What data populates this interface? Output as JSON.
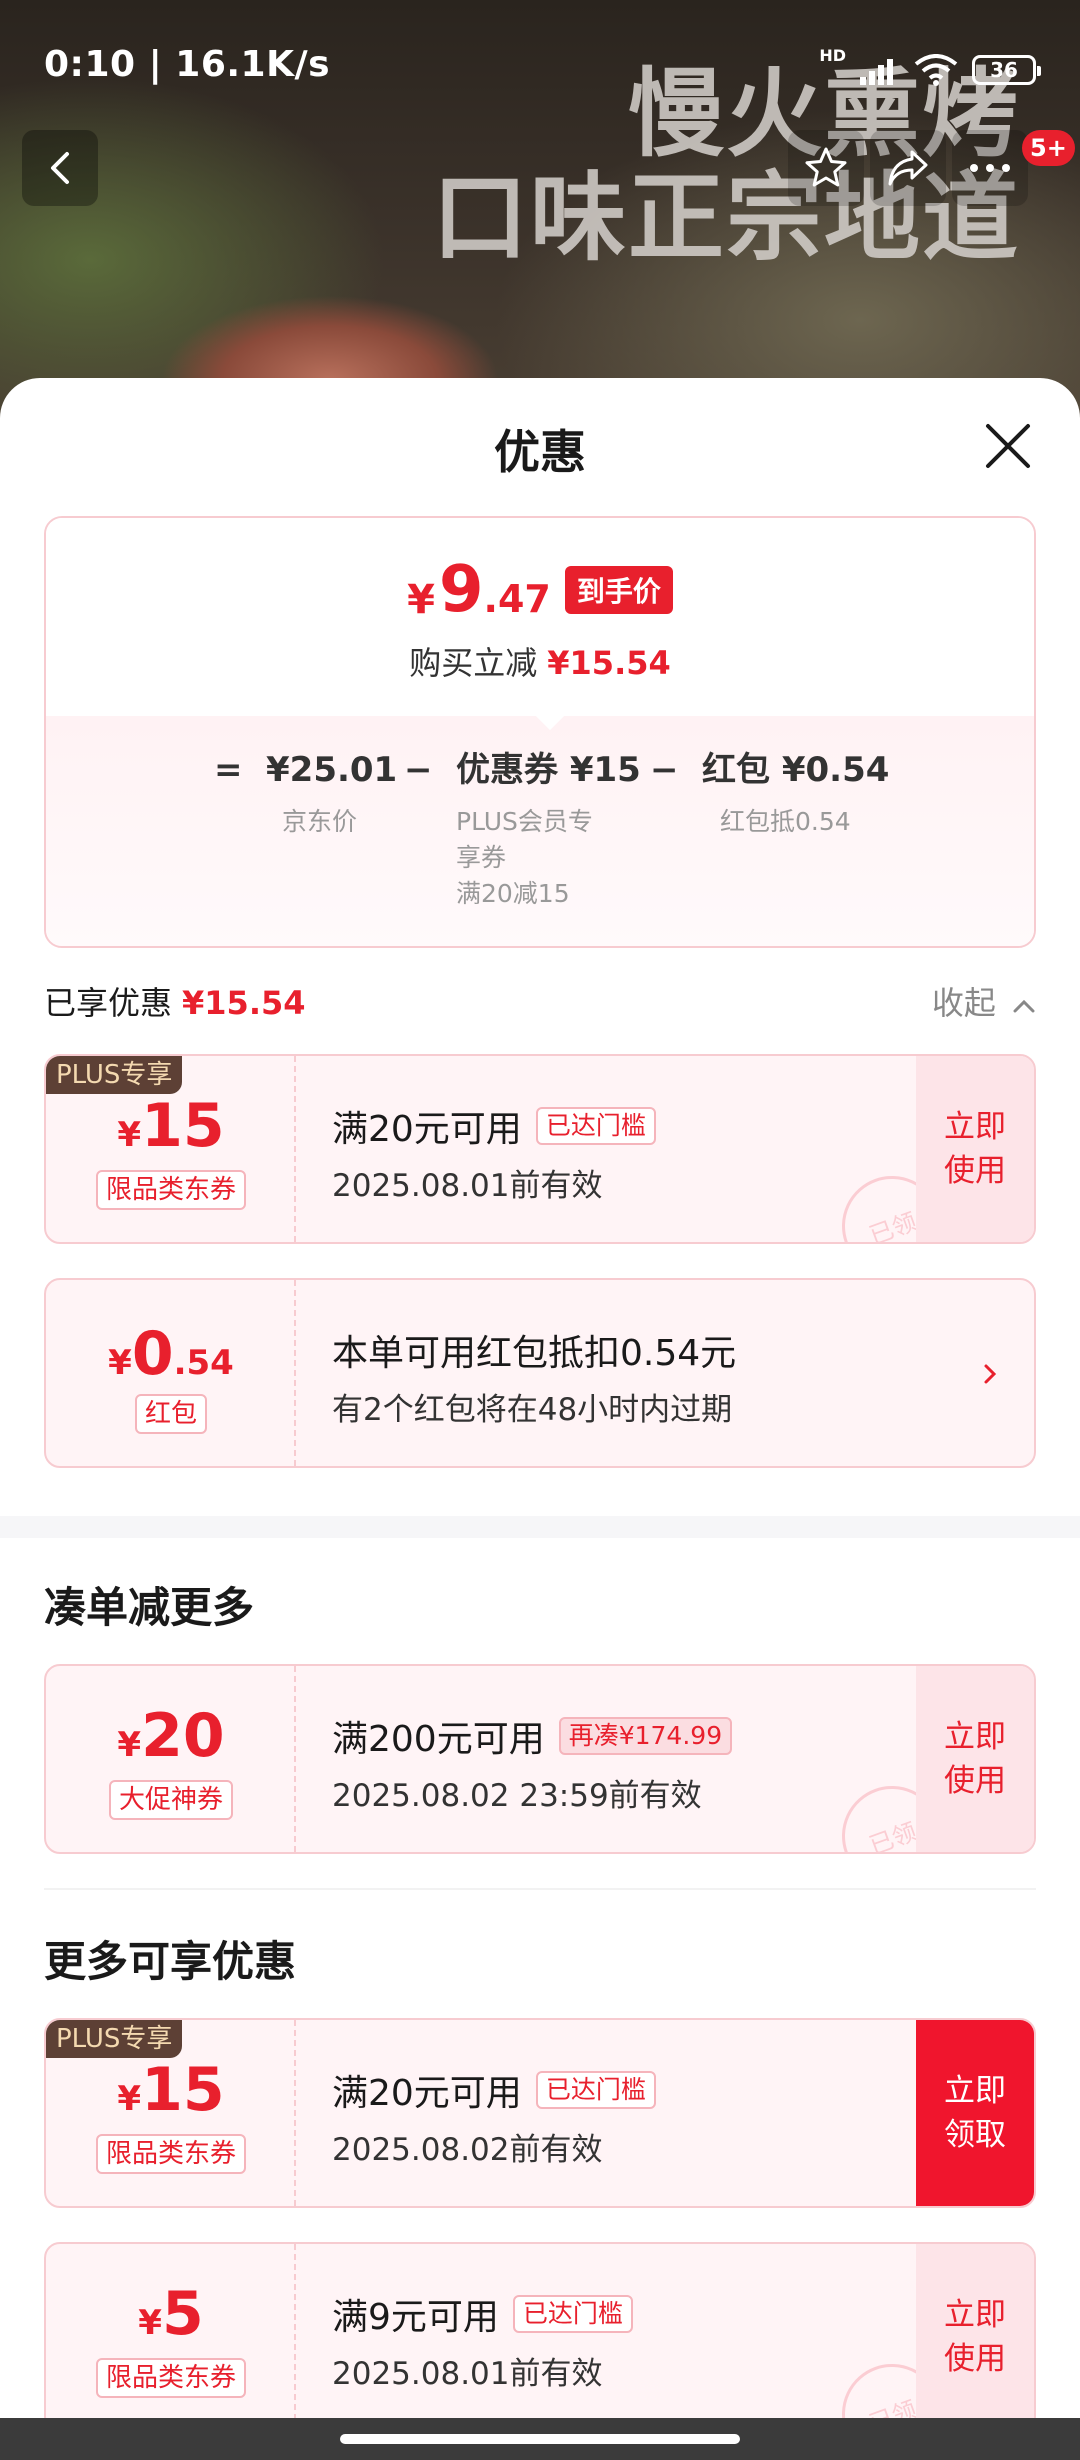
{
  "status_bar": {
    "time": "0:10",
    "speed": "16.1K/s",
    "network_label": "HD",
    "battery": "36"
  },
  "hero": {
    "slogan_line1": "慢火熏烤",
    "slogan_line2": "口味正宗地道",
    "notification_badge": "5+"
  },
  "sheet": {
    "title": "优惠",
    "price": {
      "currency": "¥",
      "integer": "9",
      "decimal": ".47",
      "tag": "到手价",
      "saving_label": "购买立减",
      "saving_value": "¥15.54"
    },
    "formula": {
      "equals": "=",
      "jd_price": "¥25.01",
      "minus": "−",
      "coupon": "优惠券 ¥15",
      "red_packet": "红包 ¥0.54",
      "jd_price_label": "京东价",
      "coupon_label_line1": "PLUS会员专",
      "coupon_label_line2": "享券",
      "coupon_label_line3": "满20减15",
      "red_packet_label": "红包抵0.54"
    },
    "enjoyed_label": "已享优惠",
    "enjoyed_value": "¥15.54",
    "collapse_label": "收起"
  },
  "enjoyed_coupons": [
    {
      "plus_tag": "PLUS专享",
      "currency": "¥",
      "amount": "15",
      "kind": "限品类东券",
      "condition": "满20元可用",
      "status": "已达门槛",
      "validity": "2025.08.01前有效",
      "action": "立即使用",
      "stamp": "已领"
    },
    {
      "currency": "¥",
      "amount": "0",
      "decimal": ".54",
      "kind": "红包",
      "condition": "本单可用红包抵扣0.54元",
      "validity": "有2个红包将在48小时内过期"
    }
  ],
  "section_more_reduce": {
    "title": "凑单减更多",
    "coupon": {
      "currency": "¥",
      "amount": "20",
      "kind": "大促神券",
      "condition": "满200元可用",
      "status": "再凑¥174.99",
      "validity": "2025.08.02 23:59前有效",
      "action": "立即使用",
      "stamp": "已领"
    }
  },
  "section_more_offers": {
    "title": "更多可享优惠",
    "coupons": [
      {
        "plus_tag": "PLUS专享",
        "currency": "¥",
        "amount": "15",
        "kind": "限品类东券",
        "condition": "满20元可用",
        "status": "已达门槛",
        "validity": "2025.08.02前有效",
        "action": "立即领取"
      },
      {
        "currency": "¥",
        "amount": "5",
        "kind": "限品类东券",
        "condition": "满9元可用",
        "status": "已达门槛",
        "validity": "2025.08.01前有效",
        "action": "立即使用",
        "stamp": "已领"
      }
    ]
  },
  "colors": {
    "accent": "#e8202d",
    "coupon_bg": "#fff4f6",
    "coupon_border": "#f7cbd0"
  }
}
